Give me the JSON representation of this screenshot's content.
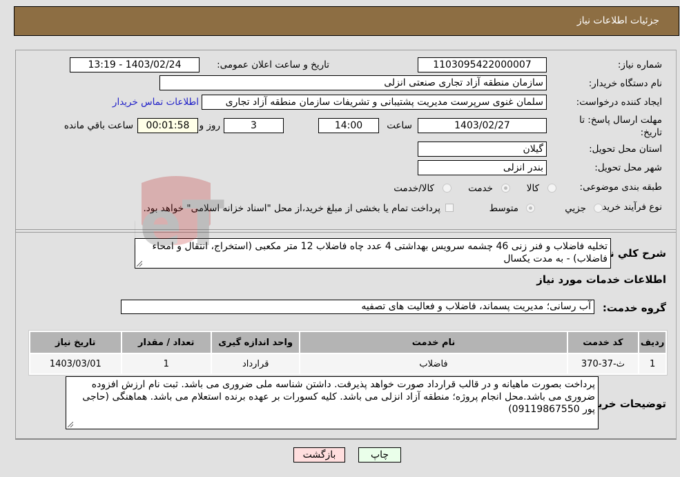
{
  "header": {
    "title": "جزئیات اطلاعات نیاز"
  },
  "form": {
    "need_number": {
      "label": "شماره نیاز:",
      "value": "1103095422000007"
    },
    "announce_datetime": {
      "label": "تاریخ و ساعت اعلان عمومی:",
      "value": "1403/02/24 - 13:19"
    },
    "buyer_org": {
      "label": "نام دستگاه خریدار:",
      "value": "سازمان منطقه آزاد تجاری  صنعتی انزلی"
    },
    "requester": {
      "label": "ایجاد کننده درخواست:",
      "value": "سلمان غنوی سرپرست مدیریت پشتیبانی و تشریفات سازمان منطقه آزاد تجاری",
      "contact_link": "اطلاعات تماس خریدار"
    },
    "deadline": {
      "label": "مهلت ارسال پاسخ: تا تاریخ:",
      "date": "1403/02/27",
      "time_label": "ساعت",
      "time": "14:00",
      "days": "3",
      "days_label": "روز و",
      "remaining": "00:01:58",
      "remaining_label": "ساعت باقي مانده"
    },
    "province": {
      "label": "استان محل تحویل:",
      "value": "گیلان"
    },
    "city": {
      "label": "شهر محل تحویل:",
      "value": "بندر انزلی"
    },
    "category": {
      "label": "طبقه بندی موضوعی:",
      "options": [
        "کالا",
        "خدمت",
        "کالا/خدمت"
      ],
      "selected": "خدمت"
    },
    "purchase_type": {
      "label": "نوع فرآیند خرید :",
      "options": [
        "جزيي",
        "متوسط"
      ],
      "selected": "متوسط",
      "treasury_checkbox_label": "پرداخت تمام یا بخشی از مبلغ خرید،از محل \"اسناد خزانه اسلامی\" خواهد بود.",
      "treasury_checked": false
    }
  },
  "description": {
    "label": "شرح کلي نياز:",
    "value": "تخلیه فاضلاب و فنر زنی 46 چشمه سرویس بهداشتی 4 عدد چاه فاضلاب 12 متر مکعبی (استخراج، انتقال و امحاء فاضلاب) - به مدت یکسال"
  },
  "services_section": {
    "title": "اطلاعات خدمات مورد نیاز",
    "group_label": "گروه خدمت:",
    "group_value": "آب رسانی؛ مدیریت پسماند، فاضلاب و فعالیت های تصفیه"
  },
  "table": {
    "columns": [
      "ردیف",
      "کد خدمت",
      "نام خدمت",
      "واحد اندازه گیری",
      "تعداد / مقدار",
      "تاریخ نیاز"
    ],
    "rows": [
      [
        "1",
        "ث-37-370",
        "فاضلاب",
        "قرارداد",
        "1",
        "1403/03/01"
      ]
    ]
  },
  "buyer_notes": {
    "label": "توضیحات خریدار:",
    "value": "پرداخت بصورت ماهیانه و در قالب قرارداد صورت خواهد پذیرفت. داشتن شناسه ملی ضروری می باشد. ثبت نام ارزش افزوده ضروری می باشد.محل انجام پروژه؛ منطقه آزاد انزلی می باشد. کلیه کسورات بر عهده برنده استعلام می باشد. هماهنگی (حاجی پور 09119867550)"
  },
  "buttons": {
    "print": "چاپ",
    "back": "بازگشت"
  },
  "colors": {
    "header_bg": "#8d6e43",
    "link": "#2020c8",
    "print_bg": "#eaffea",
    "back_bg": "#ffdede"
  }
}
